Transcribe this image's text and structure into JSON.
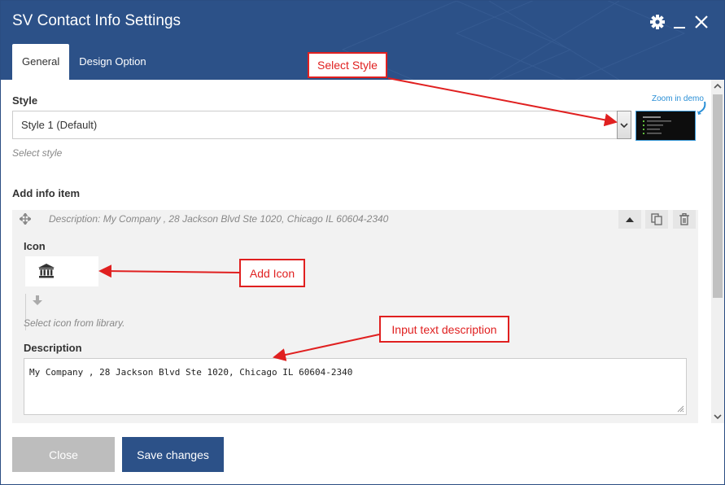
{
  "dialog": {
    "title": "SV Contact Info Settings",
    "tabs": [
      {
        "label": "General",
        "active": true
      },
      {
        "label": "Design Option",
        "active": false
      }
    ]
  },
  "style_field": {
    "label": "Style",
    "selected": "Style 1 (Default)",
    "hint": "Select style",
    "zoom_link": "Zoom in demo"
  },
  "info_item": {
    "section_label": "Add info item",
    "item_summary": "Description: My Company , 28 Jackson Blvd Ste 1020, Chicago IL 60604-2340",
    "icon_label": "Icon",
    "icon_hint": "Select icon from library.",
    "description_label": "Description",
    "description_value": "My Company , 28 Jackson Blvd Ste 1020, Chicago IL 60604-2340"
  },
  "footer": {
    "close_label": "Close",
    "save_label": "Save changes"
  },
  "annotations": [
    {
      "text": "Select Style"
    },
    {
      "text": "Add Icon"
    },
    {
      "text": "Input text description"
    }
  ],
  "icons": {
    "settings": "gear-icon",
    "minimize": "minimize-icon",
    "close": "close-icon",
    "move": "move-icon",
    "collapse": "caret-up-icon",
    "clone": "copy-icon",
    "delete": "trash-icon",
    "selected_icon": "institution-icon",
    "change_icon": "arrow-down-icon"
  },
  "colors": {
    "header": "#2c5188",
    "primary_button": "#2c5188",
    "disabled_button": "#bdbdbd",
    "annotation": "#e02020",
    "link": "#2a8fd6"
  }
}
